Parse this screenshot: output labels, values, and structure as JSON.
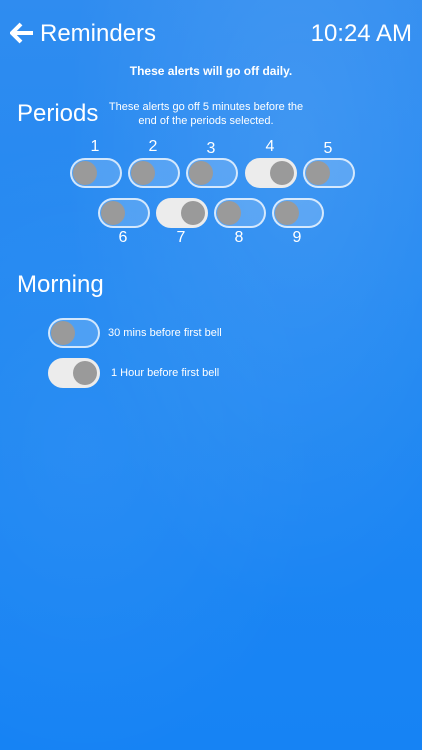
{
  "header": {
    "title": "Reminders",
    "time": "10:24 AM",
    "back_icon": "arrow-left-icon"
  },
  "subtitle": "These alerts will go off daily.",
  "periods": {
    "title": "Periods",
    "note": "These alerts go off 5 minutes before the end of the periods selected.",
    "items": [
      {
        "label": "1",
        "on": false
      },
      {
        "label": "2",
        "on": false
      },
      {
        "label": "3",
        "on": false
      },
      {
        "label": "4",
        "on": true
      },
      {
        "label": "5",
        "on": false
      },
      {
        "label": "6",
        "on": false
      },
      {
        "label": "7",
        "on": true
      },
      {
        "label": "8",
        "on": false
      },
      {
        "label": "9",
        "on": false
      }
    ]
  },
  "morning": {
    "title": "Morning",
    "items": [
      {
        "label": "30 mins before first bell",
        "on": false
      },
      {
        "label": "1 Hour before first bell",
        "on": true
      }
    ]
  },
  "colors": {
    "background": "#2188f2",
    "toggle_on_track": "#ececec",
    "toggle_knob": "#9a9a9a"
  }
}
